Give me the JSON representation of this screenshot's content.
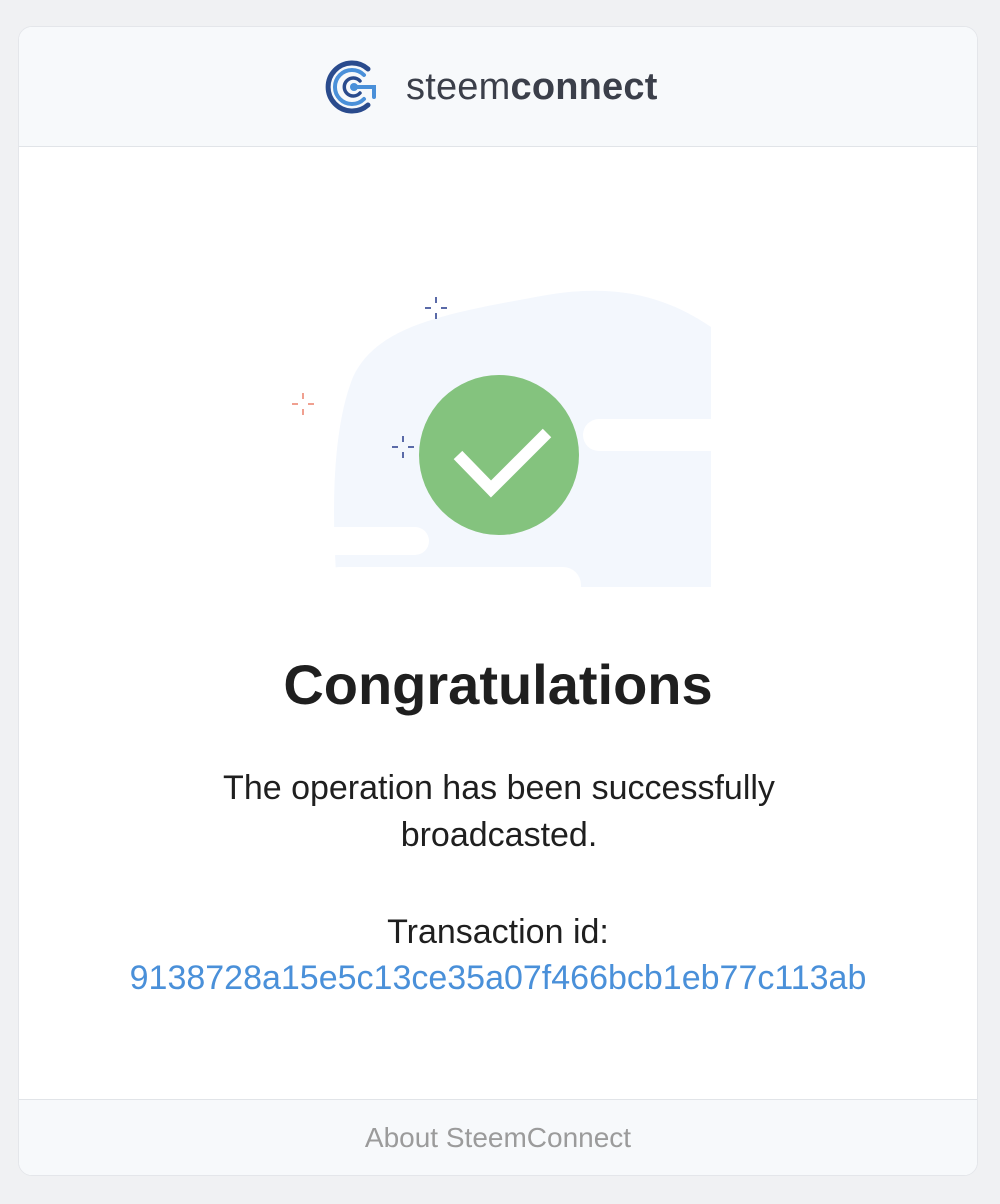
{
  "header": {
    "brand_light": "steem",
    "brand_bold": "connect",
    "logo_icon": "steemconnect-logo-icon"
  },
  "illustration": {
    "icon": "success-checkmark-icon",
    "success_color": "#84c37e",
    "sparkle_colors": [
      "#5a6aa8",
      "#f0a090"
    ]
  },
  "main": {
    "title": "Congratulations",
    "message": "The operation has been successfully broadcasted.",
    "tx_label": "Transaction id:",
    "tx_id": "9138728a15e5c13ce35a07f466bcb1eb77c113ab"
  },
  "footer": {
    "about_link": "About SteemConnect"
  },
  "colors": {
    "link": "#4a90d9",
    "text": "#1f1f1f",
    "muted": "#9b9b9b",
    "page_bg": "#f0f1f3"
  }
}
